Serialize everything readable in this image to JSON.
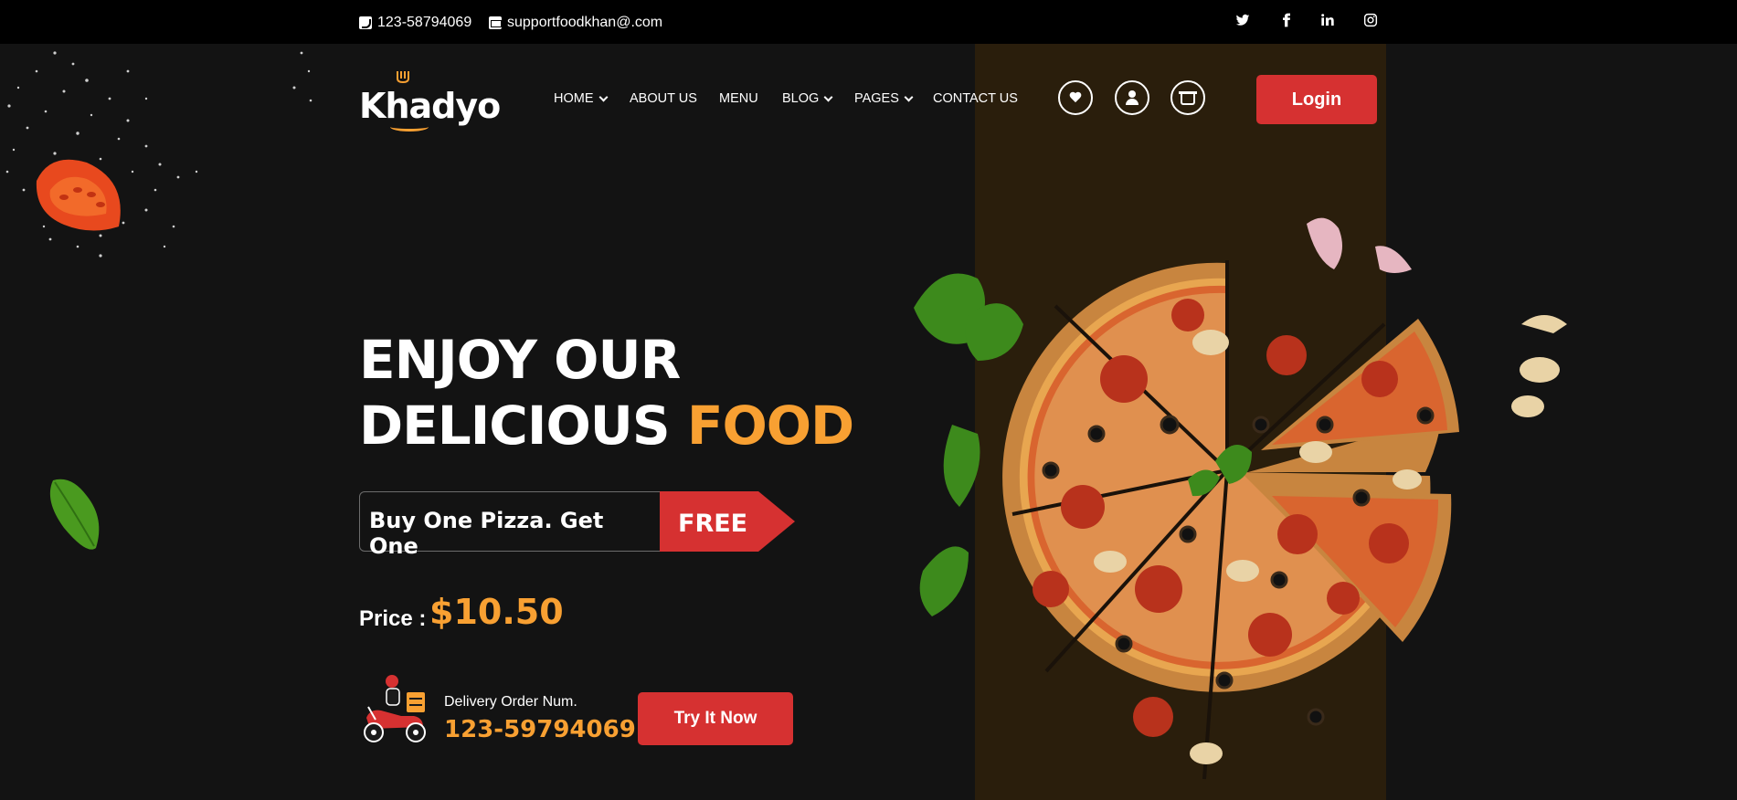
{
  "topbar": {
    "phone": "123-58794069",
    "email": "supportfoodkhan@.com",
    "social": [
      {
        "icon": "twitter-icon",
        "glyph": "𝕥"
      },
      {
        "icon": "facebook-icon",
        "glyph": "f"
      },
      {
        "icon": "linkedin-icon",
        "glyph": "in"
      },
      {
        "icon": "instagram-icon",
        "glyph": "◎"
      }
    ]
  },
  "header": {
    "logo_text": "Khadyo",
    "nav": [
      {
        "label": "HOME",
        "dropdown": true
      },
      {
        "label": "ABOUT US",
        "dropdown": false
      },
      {
        "label": "MENU",
        "dropdown": false
      },
      {
        "label": "BLOG",
        "dropdown": true
      },
      {
        "label": "PAGES",
        "dropdown": true
      },
      {
        "label": "CONTACT US",
        "dropdown": false
      }
    ],
    "icons": [
      "heart-icon",
      "user-icon",
      "basket-icon"
    ],
    "login_label": "Login"
  },
  "hero": {
    "title_line1": "ENJOY OUR",
    "title_line2_a": "DELICIOUS",
    "title_line2_b": "FOOD",
    "offer_text": "Buy One Pizza. Get One",
    "offer_tag": "FREE",
    "price_label": "Price :",
    "price_value": "$10.50",
    "delivery_label": "Delivery Order Num.",
    "delivery_number": "123-59794069",
    "cta_label": "Try It Now"
  },
  "colors": {
    "accent_orange": "#f8a032",
    "accent_red": "#d63131",
    "background": "#131313",
    "topbar": "#000000",
    "amber_column": "#2a1e0c"
  }
}
